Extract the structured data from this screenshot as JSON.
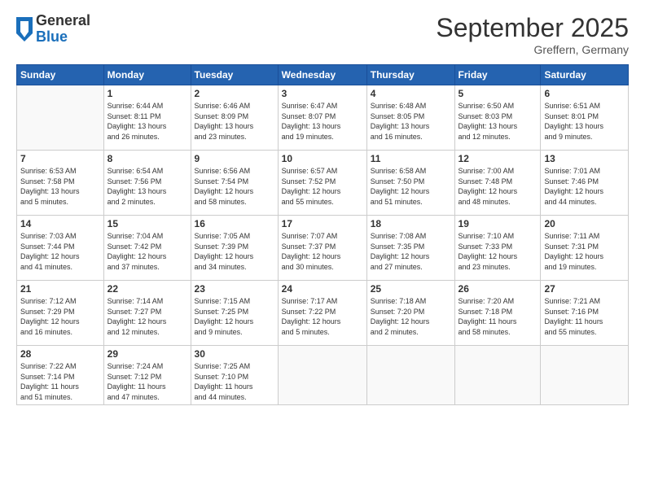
{
  "header": {
    "logo_general": "General",
    "logo_blue": "Blue",
    "month_title": "September 2025",
    "location": "Greffern, Germany"
  },
  "days_of_week": [
    "Sunday",
    "Monday",
    "Tuesday",
    "Wednesday",
    "Thursday",
    "Friday",
    "Saturday"
  ],
  "weeks": [
    [
      {
        "day": "",
        "info": ""
      },
      {
        "day": "1",
        "info": "Sunrise: 6:44 AM\nSunset: 8:11 PM\nDaylight: 13 hours\nand 26 minutes."
      },
      {
        "day": "2",
        "info": "Sunrise: 6:46 AM\nSunset: 8:09 PM\nDaylight: 13 hours\nand 23 minutes."
      },
      {
        "day": "3",
        "info": "Sunrise: 6:47 AM\nSunset: 8:07 PM\nDaylight: 13 hours\nand 19 minutes."
      },
      {
        "day": "4",
        "info": "Sunrise: 6:48 AM\nSunset: 8:05 PM\nDaylight: 13 hours\nand 16 minutes."
      },
      {
        "day": "5",
        "info": "Sunrise: 6:50 AM\nSunset: 8:03 PM\nDaylight: 13 hours\nand 12 minutes."
      },
      {
        "day": "6",
        "info": "Sunrise: 6:51 AM\nSunset: 8:01 PM\nDaylight: 13 hours\nand 9 minutes."
      }
    ],
    [
      {
        "day": "7",
        "info": "Sunrise: 6:53 AM\nSunset: 7:58 PM\nDaylight: 13 hours\nand 5 minutes."
      },
      {
        "day": "8",
        "info": "Sunrise: 6:54 AM\nSunset: 7:56 PM\nDaylight: 13 hours\nand 2 minutes."
      },
      {
        "day": "9",
        "info": "Sunrise: 6:56 AM\nSunset: 7:54 PM\nDaylight: 12 hours\nand 58 minutes."
      },
      {
        "day": "10",
        "info": "Sunrise: 6:57 AM\nSunset: 7:52 PM\nDaylight: 12 hours\nand 55 minutes."
      },
      {
        "day": "11",
        "info": "Sunrise: 6:58 AM\nSunset: 7:50 PM\nDaylight: 12 hours\nand 51 minutes."
      },
      {
        "day": "12",
        "info": "Sunrise: 7:00 AM\nSunset: 7:48 PM\nDaylight: 12 hours\nand 48 minutes."
      },
      {
        "day": "13",
        "info": "Sunrise: 7:01 AM\nSunset: 7:46 PM\nDaylight: 12 hours\nand 44 minutes."
      }
    ],
    [
      {
        "day": "14",
        "info": "Sunrise: 7:03 AM\nSunset: 7:44 PM\nDaylight: 12 hours\nand 41 minutes."
      },
      {
        "day": "15",
        "info": "Sunrise: 7:04 AM\nSunset: 7:42 PM\nDaylight: 12 hours\nand 37 minutes."
      },
      {
        "day": "16",
        "info": "Sunrise: 7:05 AM\nSunset: 7:39 PM\nDaylight: 12 hours\nand 34 minutes."
      },
      {
        "day": "17",
        "info": "Sunrise: 7:07 AM\nSunset: 7:37 PM\nDaylight: 12 hours\nand 30 minutes."
      },
      {
        "day": "18",
        "info": "Sunrise: 7:08 AM\nSunset: 7:35 PM\nDaylight: 12 hours\nand 27 minutes."
      },
      {
        "day": "19",
        "info": "Sunrise: 7:10 AM\nSunset: 7:33 PM\nDaylight: 12 hours\nand 23 minutes."
      },
      {
        "day": "20",
        "info": "Sunrise: 7:11 AM\nSunset: 7:31 PM\nDaylight: 12 hours\nand 19 minutes."
      }
    ],
    [
      {
        "day": "21",
        "info": "Sunrise: 7:12 AM\nSunset: 7:29 PM\nDaylight: 12 hours\nand 16 minutes."
      },
      {
        "day": "22",
        "info": "Sunrise: 7:14 AM\nSunset: 7:27 PM\nDaylight: 12 hours\nand 12 minutes."
      },
      {
        "day": "23",
        "info": "Sunrise: 7:15 AM\nSunset: 7:25 PM\nDaylight: 12 hours\nand 9 minutes."
      },
      {
        "day": "24",
        "info": "Sunrise: 7:17 AM\nSunset: 7:22 PM\nDaylight: 12 hours\nand 5 minutes."
      },
      {
        "day": "25",
        "info": "Sunrise: 7:18 AM\nSunset: 7:20 PM\nDaylight: 12 hours\nand 2 minutes."
      },
      {
        "day": "26",
        "info": "Sunrise: 7:20 AM\nSunset: 7:18 PM\nDaylight: 11 hours\nand 58 minutes."
      },
      {
        "day": "27",
        "info": "Sunrise: 7:21 AM\nSunset: 7:16 PM\nDaylight: 11 hours\nand 55 minutes."
      }
    ],
    [
      {
        "day": "28",
        "info": "Sunrise: 7:22 AM\nSunset: 7:14 PM\nDaylight: 11 hours\nand 51 minutes."
      },
      {
        "day": "29",
        "info": "Sunrise: 7:24 AM\nSunset: 7:12 PM\nDaylight: 11 hours\nand 47 minutes."
      },
      {
        "day": "30",
        "info": "Sunrise: 7:25 AM\nSunset: 7:10 PM\nDaylight: 11 hours\nand 44 minutes."
      },
      {
        "day": "",
        "info": ""
      },
      {
        "day": "",
        "info": ""
      },
      {
        "day": "",
        "info": ""
      },
      {
        "day": "",
        "info": ""
      }
    ]
  ]
}
